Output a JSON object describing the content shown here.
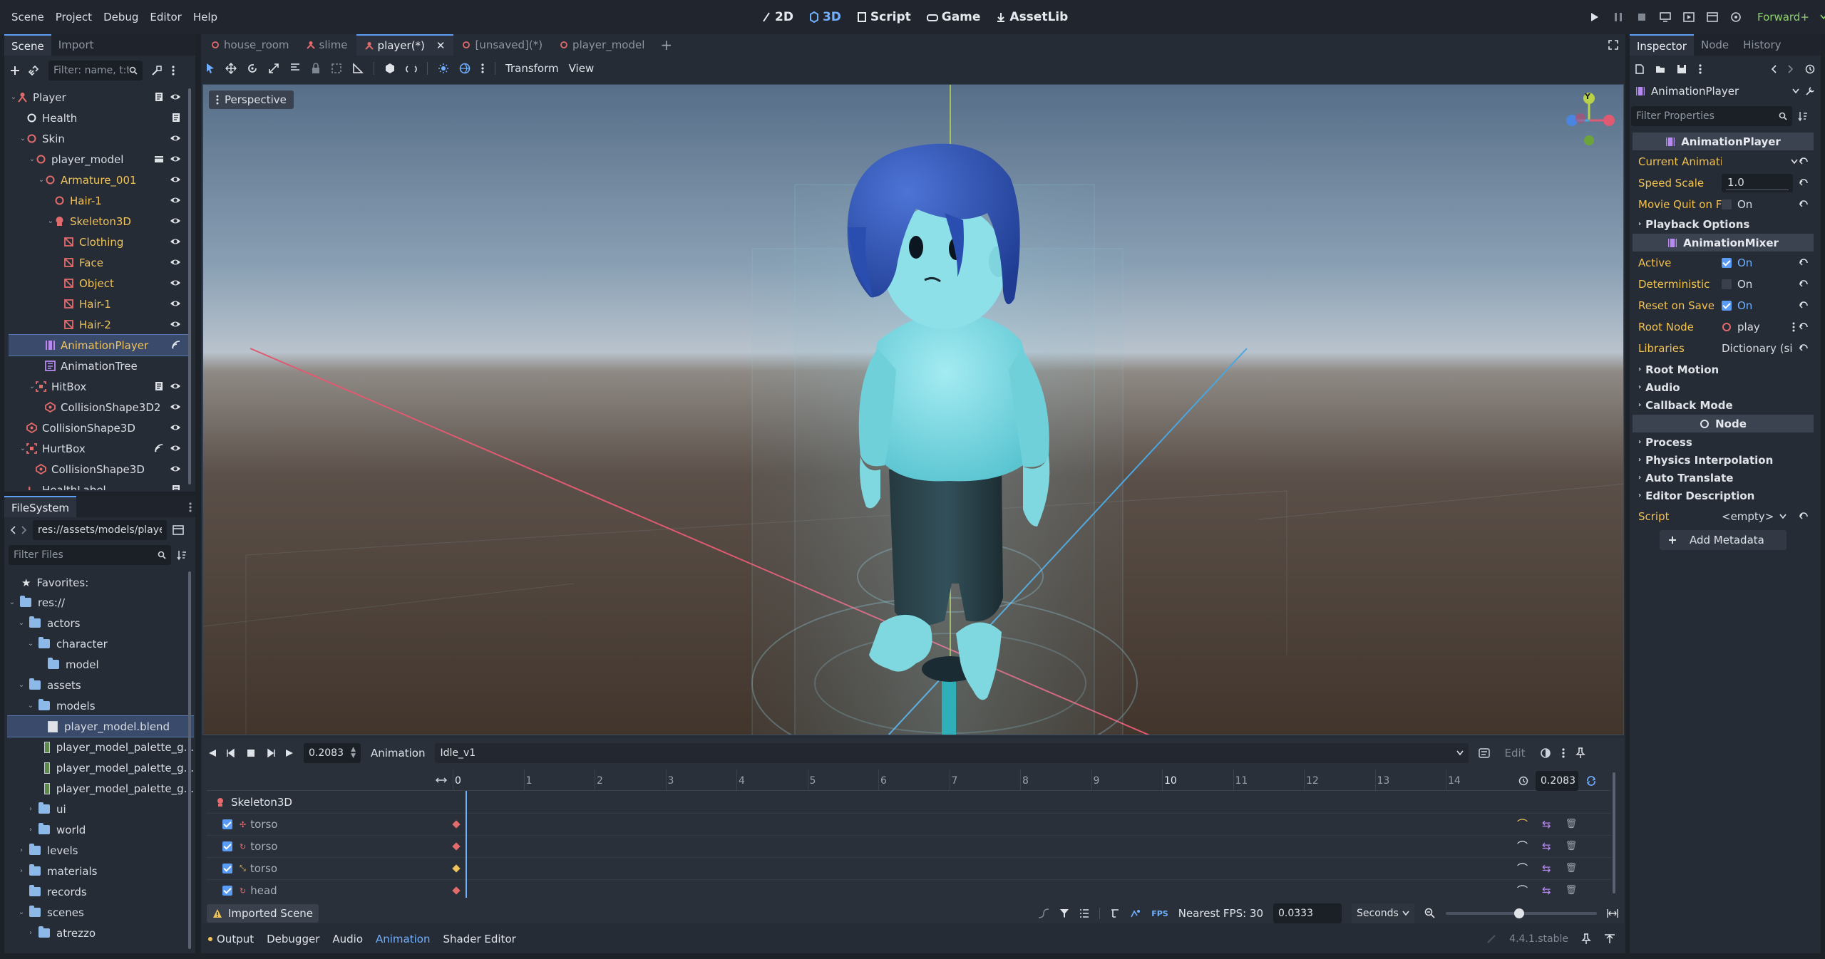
{
  "menu": [
    "Scene",
    "Project",
    "Debug",
    "Editor",
    "Help"
  ],
  "workspaces": [
    {
      "label": "2D",
      "icon": "2d-icon",
      "active": false
    },
    {
      "label": "3D",
      "icon": "3d-icon",
      "active": true
    },
    {
      "label": "Script",
      "icon": "script-icon",
      "active": false
    },
    {
      "label": "Game",
      "icon": "game-icon",
      "active": false
    },
    {
      "label": "AssetLib",
      "icon": "assetlib-icon",
      "active": false
    }
  ],
  "renderer": "Forward+",
  "scene_dock": {
    "tabs": [
      "Scene",
      "Import"
    ],
    "filter_placeholder": "Filter: name, t:t",
    "nodes": [
      {
        "label": "Player",
        "depth": 0,
        "icon": "character-body-icon",
        "color": "#e46b6b",
        "text": "#d8dce2",
        "script": true,
        "eye": true,
        "tri": "v"
      },
      {
        "label": "Health",
        "depth": 1,
        "icon": "node-icon",
        "color": "#e6e9ee",
        "text": "#d8dce2",
        "script": true,
        "eye": false,
        "tri": ""
      },
      {
        "label": "Skin",
        "depth": 1,
        "icon": "node3d-icon",
        "color": "#e46b6b",
        "text": "#d8dce2",
        "script": false,
        "eye": true,
        "tri": "v"
      },
      {
        "label": "player_model",
        "depth": 2,
        "icon": "node3d-icon",
        "color": "#e46b6b",
        "text": "#d8dce2",
        "script": false,
        "eye": true,
        "tri": "v",
        "scene": true
      },
      {
        "label": "Armature_001",
        "depth": 3,
        "icon": "node3d-icon",
        "color": "#e46b6b",
        "text": "#f0c35a",
        "script": false,
        "eye": true,
        "tri": "v"
      },
      {
        "label": "Hair-1",
        "depth": 4,
        "icon": "node3d-icon",
        "color": "#e46b6b",
        "text": "#f0c35a",
        "script": false,
        "eye": true,
        "tri": ""
      },
      {
        "label": "Skeleton3D",
        "depth": 4,
        "icon": "skeleton-icon",
        "color": "#e46b6b",
        "text": "#f0c35a",
        "script": false,
        "eye": true,
        "tri": "v"
      },
      {
        "label": "Clothing",
        "depth": 5,
        "icon": "mesh-icon",
        "color": "#e46b6b",
        "text": "#f0c35a",
        "script": false,
        "eye": true,
        "tri": ""
      },
      {
        "label": "Face",
        "depth": 5,
        "icon": "mesh-icon",
        "color": "#e46b6b",
        "text": "#f0c35a",
        "script": false,
        "eye": true,
        "tri": ""
      },
      {
        "label": "Object",
        "depth": 5,
        "icon": "mesh-icon",
        "color": "#e46b6b",
        "text": "#f0c35a",
        "script": false,
        "eye": true,
        "tri": ""
      },
      {
        "label": "Hair-1",
        "depth": 5,
        "icon": "mesh-icon",
        "color": "#e46b6b",
        "text": "#f0c35a",
        "script": false,
        "eye": true,
        "tri": ""
      },
      {
        "label": "Hair-2",
        "depth": 5,
        "icon": "mesh-icon",
        "color": "#e46b6b",
        "text": "#f0c35a",
        "script": false,
        "eye": true,
        "tri": ""
      },
      {
        "label": "AnimationPlayer",
        "depth": 3,
        "icon": "animation-player-icon",
        "color": "#b68af0",
        "text": "#f0c35a",
        "script": false,
        "eye": false,
        "tri": "",
        "selected": true,
        "signal": true
      },
      {
        "label": "AnimationTree",
        "depth": 3,
        "icon": "animation-tree-icon",
        "color": "#b68af0",
        "text": "#d8dce2",
        "script": false,
        "eye": false,
        "tri": ""
      },
      {
        "label": "HitBox",
        "depth": 2,
        "icon": "area3d-icon",
        "color": "#e46b6b",
        "text": "#d8dce2",
        "script": true,
        "eye": true,
        "tri": "v"
      },
      {
        "label": "CollisionShape3D2",
        "depth": 3,
        "icon": "collision-shape-icon",
        "color": "#e46b6b",
        "text": "#d8dce2",
        "script": false,
        "eye": true,
        "tri": ""
      },
      {
        "label": "CollisionShape3D",
        "depth": 1,
        "icon": "collision-shape-icon",
        "color": "#e46b6b",
        "text": "#d8dce2",
        "script": false,
        "eye": true,
        "tri": ""
      },
      {
        "label": "HurtBox",
        "depth": 1,
        "icon": "area3d-icon",
        "color": "#e46b6b",
        "text": "#d8dce2",
        "script": false,
        "eye": true,
        "tri": "v",
        "signal": true
      },
      {
        "label": "CollisionShape3D",
        "depth": 2,
        "icon": "collision-shape-icon",
        "color": "#e46b6b",
        "text": "#d8dce2",
        "script": false,
        "eye": true,
        "tri": ""
      },
      {
        "label": "HealthLabel",
        "depth": 1,
        "icon": "label3d-icon",
        "color": "#e46b6b",
        "text": "#d8dce2",
        "script": true,
        "eye": false,
        "tri": ""
      }
    ]
  },
  "filesystem": {
    "title": "FileSystem",
    "path": "res://assets/models/playe",
    "filter_placeholder": "Filter Files",
    "favorites": "Favorites:",
    "items": [
      {
        "label": "res://",
        "depth": 0,
        "type": "folder",
        "tri": "v"
      },
      {
        "label": "actors",
        "depth": 1,
        "type": "folder",
        "tri": "v"
      },
      {
        "label": "character",
        "depth": 2,
        "type": "folder",
        "tri": "v"
      },
      {
        "label": "model",
        "depth": 3,
        "type": "folder",
        "tri": ""
      },
      {
        "label": "assets",
        "depth": 1,
        "type": "folder",
        "tri": "v"
      },
      {
        "label": "models",
        "depth": 2,
        "type": "folder",
        "tri": "v"
      },
      {
        "label": "player_model.blend",
        "depth": 3,
        "type": "file",
        "tri": "",
        "selected": true
      },
      {
        "label": "player_model_palette_g...",
        "depth": 3,
        "type": "image",
        "tri": ""
      },
      {
        "label": "player_model_palette_g...",
        "depth": 3,
        "type": "image",
        "tri": ""
      },
      {
        "label": "player_model_palette_g...",
        "depth": 3,
        "type": "image",
        "tri": ""
      },
      {
        "label": "ui",
        "depth": 2,
        "type": "folder",
        "tri": ">"
      },
      {
        "label": "world",
        "depth": 2,
        "type": "folder",
        "tri": ">"
      },
      {
        "label": "levels",
        "depth": 1,
        "type": "folder",
        "tri": ">"
      },
      {
        "label": "materials",
        "depth": 1,
        "type": "folder",
        "tri": ">"
      },
      {
        "label": "records",
        "depth": 1,
        "type": "folder",
        "tri": ""
      },
      {
        "label": "scenes",
        "depth": 1,
        "type": "folder",
        "tri": "v"
      },
      {
        "label": "atrezzo",
        "depth": 2,
        "type": "folder",
        "tri": ">"
      }
    ]
  },
  "scene_tabs": [
    {
      "label": "house_room",
      "active": false,
      "icon": "node3d-icon"
    },
    {
      "label": "slime",
      "active": false,
      "icon": "character-body-icon"
    },
    {
      "label": "player(*)",
      "active": true,
      "icon": "character-body-icon"
    },
    {
      "label": "[unsaved](*)",
      "active": false,
      "icon": "node3d-icon"
    },
    {
      "label": "player_model",
      "active": false,
      "icon": "node3d-icon"
    }
  ],
  "toolbar": {
    "transform": "Transform",
    "view": "View"
  },
  "viewport": {
    "perspective": "Perspective",
    "gizmo_y": "Y"
  },
  "animation": {
    "time": "0.2083",
    "label": "Animation",
    "current": "Idle_v1",
    "edit": "Edit",
    "cursor_time": "0.2083",
    "ruler": [
      "0",
      "1",
      "2",
      "3",
      "4",
      "5",
      "6",
      "7",
      "8",
      "9",
      "10",
      "11",
      "12",
      "13",
      "14"
    ],
    "root_track": "Skeleton3D",
    "tracks": [
      {
        "label": "torso",
        "kind": "position"
      },
      {
        "label": "torso",
        "kind": "rotation"
      },
      {
        "label": "torso",
        "kind": "scale"
      },
      {
        "label": "head",
        "kind": "rotation"
      }
    ],
    "imported": "Imported Scene",
    "snap_label": "Nearest FPS: 30",
    "snap_value": "0.0333",
    "units": "Seconds"
  },
  "bottom_tabs": [
    "Output",
    "Debugger",
    "Audio",
    "Animation",
    "Shader Editor"
  ],
  "version": "4.4.1.stable",
  "inspector": {
    "tabs": [
      "Inspector",
      "Node",
      "History"
    ],
    "object": "AnimationPlayer",
    "filter_placeholder": "Filter Properties",
    "cat1": "AnimationPlayer",
    "current_animation": "Current Animatio",
    "speed_scale_label": "Speed Scale",
    "speed_scale": "1.0",
    "movie_quit_label": "Movie Quit on Fi",
    "movie_quit_val": "On",
    "playback": "Playback Options",
    "cat2": "AnimationMixer",
    "active_label": "Active",
    "active_val": "On",
    "deterministic_label": "Deterministic",
    "deterministic_val": "On",
    "reset_label": "Reset on Save",
    "reset_val": "On",
    "root_label": "Root Node",
    "root_val": "play",
    "libraries_label": "Libraries",
    "libraries_val": "Dictionary (si",
    "sections1": [
      "Root Motion",
      "Audio",
      "Callback Mode"
    ],
    "cat3": "Node",
    "sections2": [
      "Process",
      "Physics Interpolation",
      "Auto Translate",
      "Editor Description"
    ],
    "script_label": "Script",
    "script_val": "<empty>",
    "add_metadata": "Add Metadata"
  }
}
